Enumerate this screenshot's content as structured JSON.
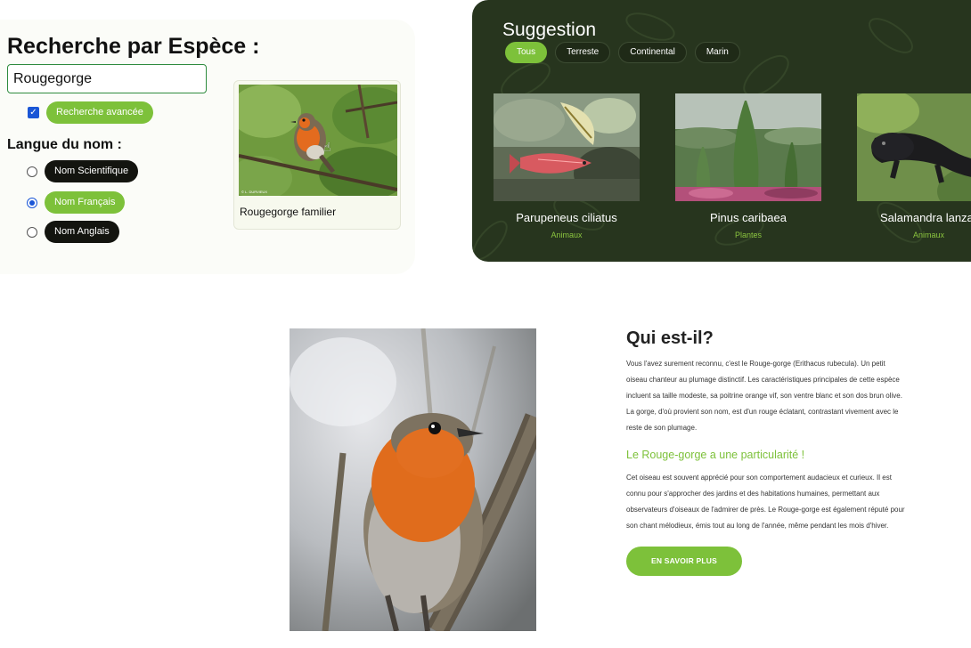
{
  "search": {
    "title": "Recherche par Espèce :",
    "input_value": "Rougegorge",
    "advanced_checked": true,
    "advanced_label": "Recherche avancée",
    "lang_title": "Langue du nom :",
    "lang_options": [
      {
        "label": "Nom Scientifique",
        "selected": false
      },
      {
        "label": "Nom Français",
        "selected": true
      },
      {
        "label": "Nom Anglais",
        "selected": false
      }
    ],
    "result": {
      "name": "Rougegorge familier",
      "credit": "© L. DURVIEUX",
      "icon": "hand-pointer-icon"
    }
  },
  "suggestion": {
    "title": "Suggestion",
    "filters": [
      {
        "label": "Tous",
        "active": true
      },
      {
        "label": "Terreste",
        "active": false
      },
      {
        "label": "Continental",
        "active": false
      },
      {
        "label": "Marin",
        "active": false
      }
    ],
    "cards": [
      {
        "name": "Parupeneus ciliatus",
        "category": "Animaux"
      },
      {
        "name": "Pinus caribaea",
        "category": "Plantes"
      },
      {
        "name": "Salamandra lanza",
        "category": "Animaux"
      }
    ]
  },
  "info": {
    "title": "Qui est-il?",
    "paragraph1_lines": [
      "Vous l'avez surement reconnu, c'est le Rouge-gorge (Erithacus rubecula). Un petit",
      "oiseau chanteur au plumage distinctif. Les caractéristiques principales de cette espèce",
      "incluent sa taille modeste, sa poitrine orange vif, son ventre blanc et son dos brun olive.",
      "La gorge, d'où provient son nom, est d'un rouge éclatant, contrastant vivement avec le",
      "reste de son plumage."
    ],
    "subtitle": "Le Rouge-gorge a une particularité !",
    "paragraph2_lines": [
      "Cet oiseau est souvent apprécié pour son comportement audacieux et curieux. Il est",
      "connu pour s'approcher des jardins et des habitations humaines, permettant aux",
      "observateurs d'oiseaux de l'admirer de près. Le Rouge-gorge est également réputé pour",
      "son chant mélodieux, émis tout au long de l'année, même pendant les mois d'hiver."
    ],
    "button_label": "EN SAVOIR PLUS"
  },
  "colors": {
    "accent": "#7dc13a",
    "dark_panel": "#27351e",
    "pill_dark": "#13140f",
    "radio_blue": "#1a56d6"
  }
}
